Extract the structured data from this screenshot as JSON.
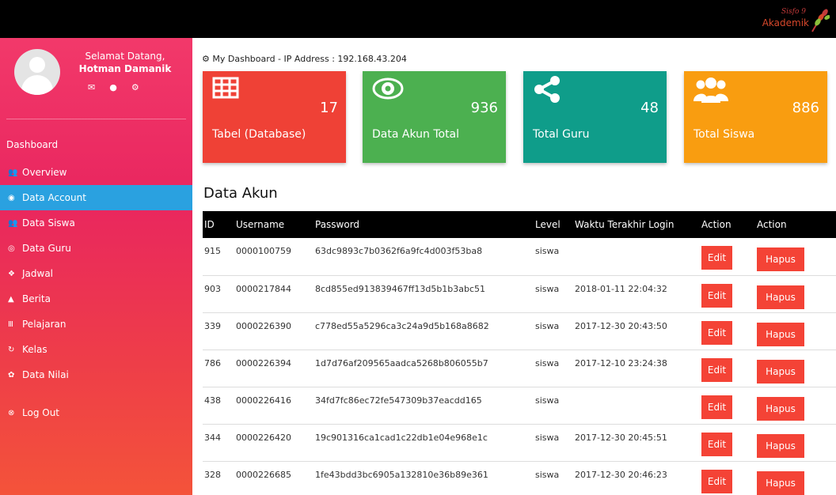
{
  "app": {
    "logo_sup": "Sisfo",
    "logo_word": "Akademik",
    "logo_sup_num": "9"
  },
  "sidebar": {
    "welcome": "Selamat Datang,",
    "user_name": "Hotman Damanik",
    "profile_icons": [
      "envelope-icon",
      "user-icon",
      "cogs-icon"
    ],
    "nav_title": "Dashboard",
    "items": [
      {
        "label": "Overview",
        "icon": "users-icon",
        "active": false
      },
      {
        "label": "Data Account",
        "icon": "eye-icon",
        "active": true
      },
      {
        "label": "Data Siswa",
        "icon": "users-icon",
        "active": false
      },
      {
        "label": "Data Guru",
        "icon": "bullseye-icon",
        "active": false
      },
      {
        "label": "Jadwal",
        "icon": "gift-icon",
        "active": false
      },
      {
        "label": "Berita",
        "icon": "bell-icon",
        "active": false
      },
      {
        "label": "Pelajaran",
        "icon": "bank-icon",
        "active": false
      },
      {
        "label": "Kelas",
        "icon": "redo-icon",
        "active": false
      },
      {
        "label": "Data Nilai",
        "icon": "gear-icon",
        "active": false
      }
    ],
    "logout": "Log Out"
  },
  "main": {
    "breadcrumb": "My Dashboard - IP Address : 192.168.43.204",
    "cards": [
      {
        "label": "Tabel (Database)",
        "value": "17",
        "color": "#ef4136",
        "icon": "table-icon"
      },
      {
        "label": "Data Akun Total",
        "value": "936",
        "color": "#4cb050",
        "icon": "eye-icon"
      },
      {
        "label": "Total Guru",
        "value": "48",
        "color": "#0f9d8a",
        "icon": "share-icon"
      },
      {
        "label": "Total Siswa",
        "value": "886",
        "color": "#f99d10",
        "icon": "users-icon"
      }
    ],
    "section_title": "Data Akun",
    "table": {
      "headers": [
        "ID",
        "Username",
        "Password",
        "Level",
        "Waktu Terakhir Login",
        "Action",
        "Action"
      ],
      "edit_label": "Edit",
      "delete_label": "Hapus",
      "rows": [
        {
          "id": "915",
          "username": "0000100759",
          "password": "63dc9893c7b0362f6a9fc4d003f53ba8",
          "level": "siswa",
          "last_login": ""
        },
        {
          "id": "903",
          "username": "0000217844",
          "password": "8cd855ed913839467ff13d5b1b3abc51",
          "level": "siswa",
          "last_login": "2018-01-11 22:04:32"
        },
        {
          "id": "339",
          "username": "0000226390",
          "password": "c778ed55a5296ca3c24a9d5b168a8682",
          "level": "siswa",
          "last_login": "2017-12-30 20:43:50"
        },
        {
          "id": "786",
          "username": "0000226394",
          "password": "1d7d76af209565aadca5268b806055b7",
          "level": "siswa",
          "last_login": "2017-12-10 23:24:38"
        },
        {
          "id": "438",
          "username": "0000226416",
          "password": "34fd7fc86ec72fe547309b37eacdd165",
          "level": "siswa",
          "last_login": ""
        },
        {
          "id": "344",
          "username": "0000226420",
          "password": "19c901316ca1cad1c22db1e04e968e1c",
          "level": "siswa",
          "last_login": "2017-12-30 20:45:51"
        },
        {
          "id": "328",
          "username": "0000226685",
          "password": "1fe43bdd3bc6905a132810e36b89e361",
          "level": "siswa",
          "last_login": "2017-12-30 20:46:23"
        }
      ]
    }
  }
}
